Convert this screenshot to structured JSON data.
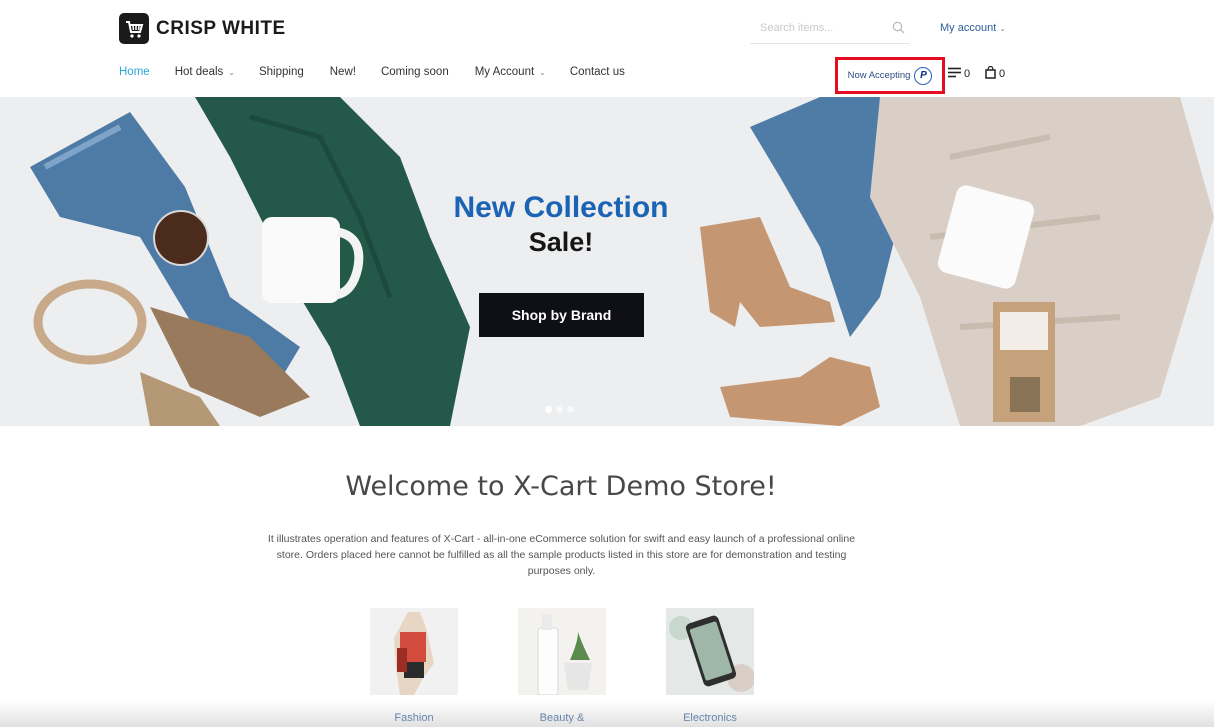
{
  "brand": {
    "name": "CRISP WHITE"
  },
  "search": {
    "placeholder": "Search items..."
  },
  "header": {
    "my_account": "My account"
  },
  "nav": {
    "items": [
      {
        "label": "Home",
        "active": true,
        "dropdown": false
      },
      {
        "label": "Hot deals",
        "active": false,
        "dropdown": true
      },
      {
        "label": "Shipping",
        "active": false,
        "dropdown": false
      },
      {
        "label": "New!",
        "active": false,
        "dropdown": false
      },
      {
        "label": "Coming soon",
        "active": false,
        "dropdown": false
      },
      {
        "label": "My Account",
        "active": false,
        "dropdown": true
      },
      {
        "label": "Contact us",
        "active": false,
        "dropdown": false
      }
    ]
  },
  "paypal": {
    "label": "Now Accepting",
    "icon": "paypal-icon",
    "highlight_color": "#e50d1f"
  },
  "compare": {
    "count": "0"
  },
  "cart": {
    "count": "0"
  },
  "banner": {
    "title": "New Collection",
    "subtitle": "Sale!",
    "button": "Shop by Brand",
    "slides": 3,
    "active_slide": 1
  },
  "welcome": {
    "title": "Welcome to X-Cart Demo Store!",
    "text": "It illustrates operation and features of X-Cart - all-in-one eCommerce solution for swift and easy launch of a professional online store. Orders placed here cannot be fulfilled as all the sample products listed in this store are for demonstration and testing purposes only."
  },
  "categories": [
    {
      "label": "Fashion"
    },
    {
      "label": "Beauty &"
    },
    {
      "label": "Electronics"
    }
  ],
  "colors": {
    "accent": "#27a8d8",
    "link": "#2d5e9a",
    "banner_title": "#1b63b4"
  }
}
